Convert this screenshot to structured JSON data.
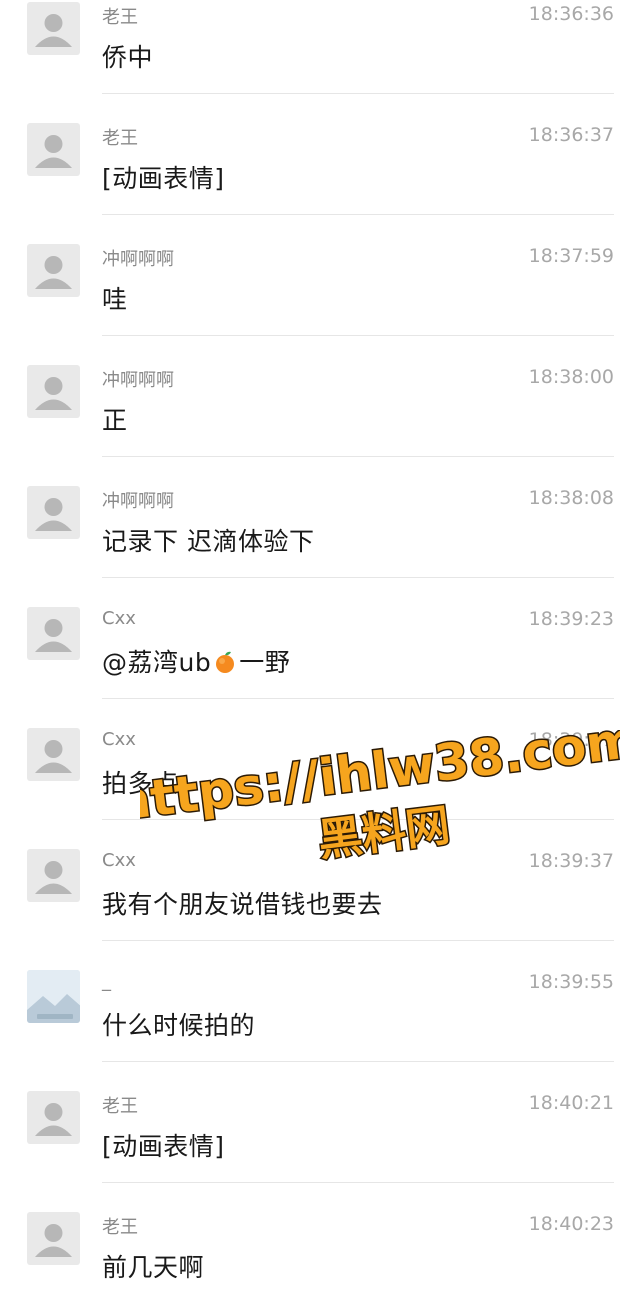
{
  "messages": [
    {
      "sender": "老王",
      "time": "18:36:36",
      "content": "侨中",
      "avatar": "default-avatar"
    },
    {
      "sender": "老王",
      "time": "18:36:37",
      "content": "[动画表情]",
      "avatar": "default-avatar"
    },
    {
      "sender": "冲啊啊啊",
      "time": "18:37:59",
      "content": "哇",
      "avatar": "default-avatar"
    },
    {
      "sender": "冲啊啊啊",
      "time": "18:38:00",
      "content": "正",
      "avatar": "default-avatar"
    },
    {
      "sender": "冲啊啊啊",
      "time": "18:38:08",
      "content": "记录下 迟滴体验下",
      "avatar": "default-avatar"
    },
    {
      "sender": "Cxx",
      "time": "18:39:23",
      "content_prefix": "@荔湾ub",
      "content_suffix": "一野",
      "emoji": "orange-emoji",
      "avatar": "default-avatar"
    },
    {
      "sender": "Cxx",
      "time": "18:39:27",
      "content": "拍多点",
      "avatar": "default-avatar"
    },
    {
      "sender": "Cxx",
      "time": "18:39:37",
      "content": "我有个朋友说借钱也要去",
      "avatar": "default-avatar"
    },
    {
      "sender": "_",
      "time": "18:39:55",
      "content": "什么时候拍的",
      "avatar": "photo-avatar"
    },
    {
      "sender": "老王",
      "time": "18:40:21",
      "content": "[动画表情]",
      "avatar": "default-avatar"
    },
    {
      "sender": "老王",
      "time": "18:40:23",
      "content": "前几天啊",
      "avatar": "default-avatar"
    }
  ],
  "watermark": {
    "line1": "https://ihlw38.com",
    "line2": "黑料网",
    "fill": "#f6a51e",
    "stroke": "#2b1a05"
  }
}
